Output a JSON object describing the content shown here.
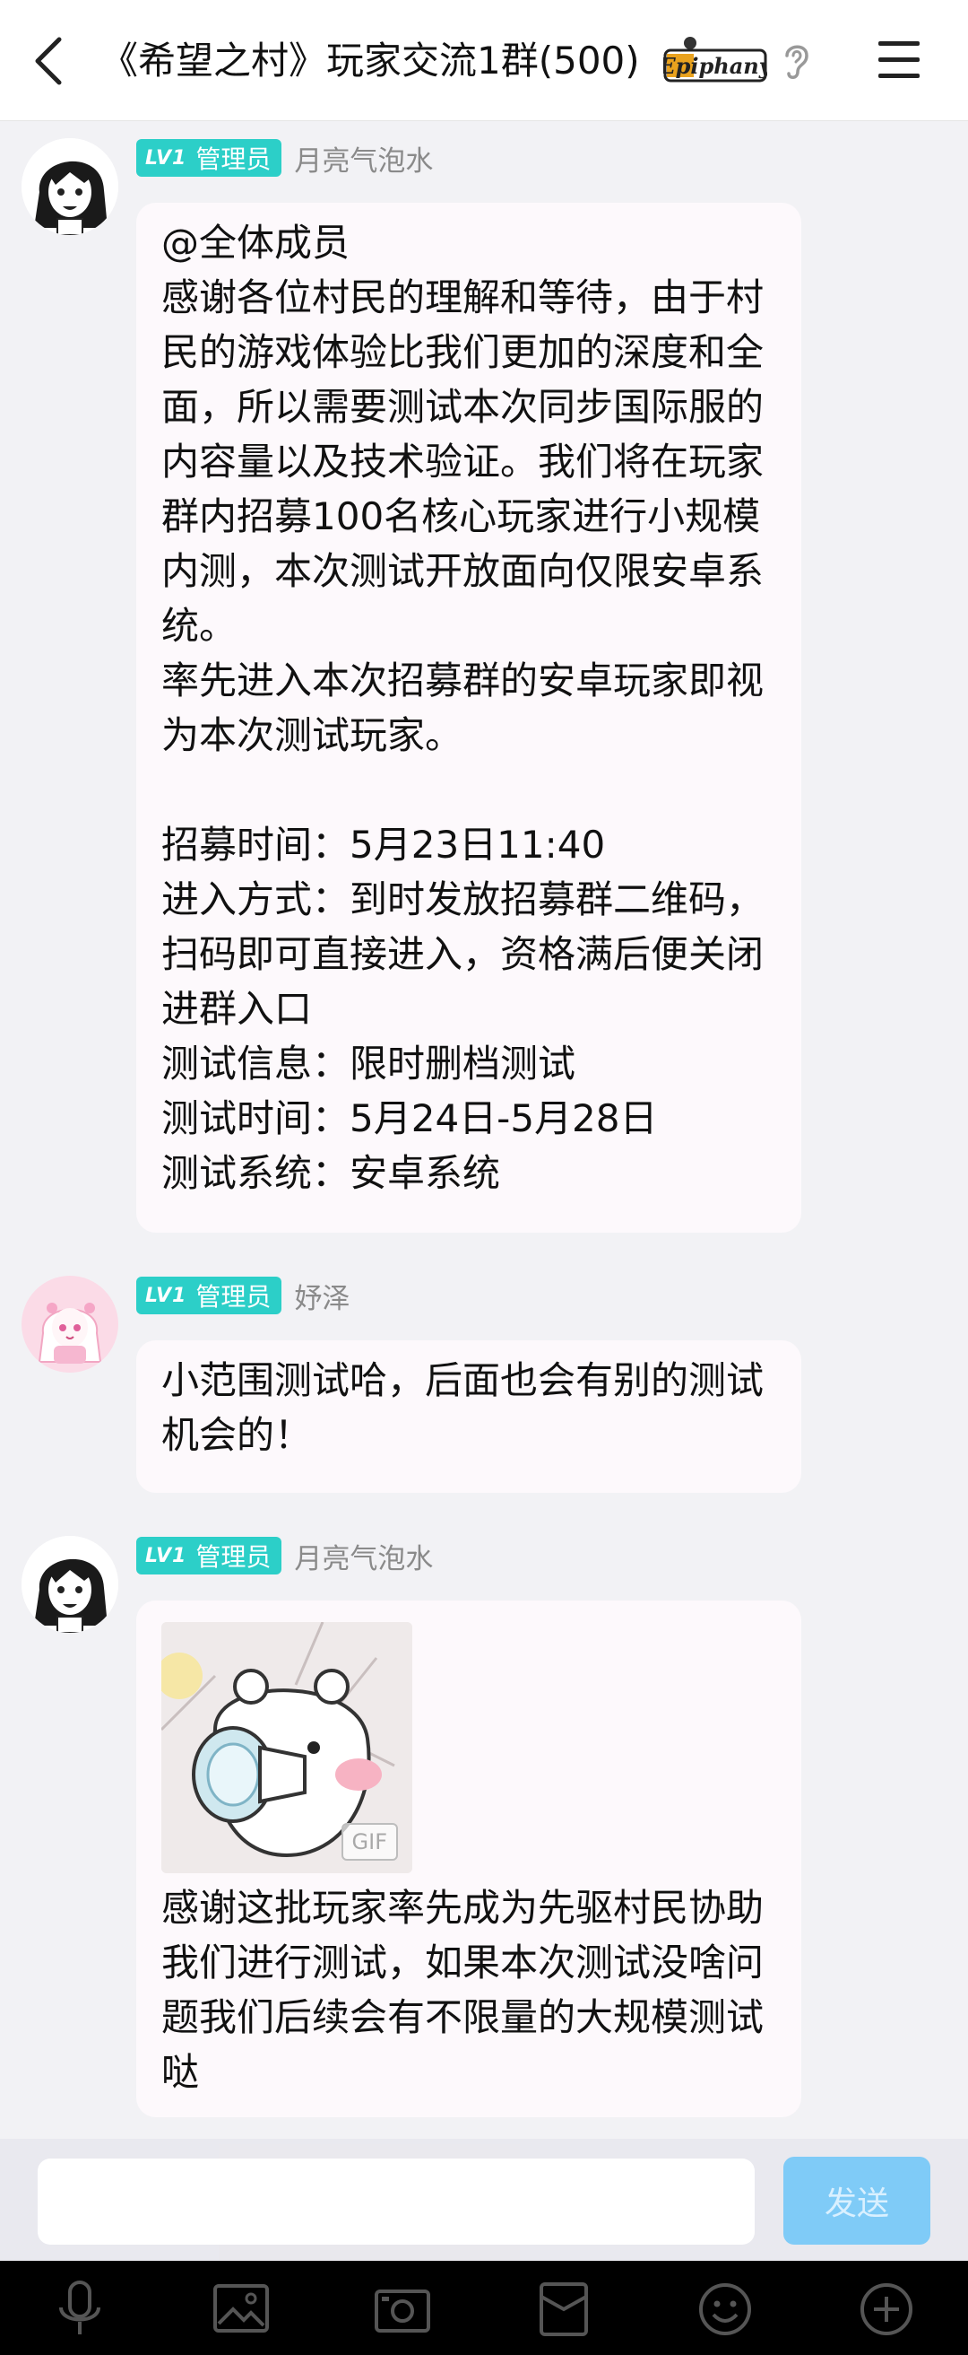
{
  "header": {
    "title": "《希望之村》玩家交流1群(500)",
    "brand_logo_text": "Epiphany"
  },
  "messages": [
    {
      "role_level": "LV1",
      "role": "管理员",
      "sender": "月亮气泡水",
      "text": "@全体成员\n感谢各位村民的理解和等待，由于村民的游戏体验比我们更加的深度和全面，所以需要测试本次同步国际服的内容量以及技术验证。我们将在玩家群内招募100名核心玩家进行小规模内测，本次测试开放面向仅限安卓系统。\n率先进入本次招募群的安卓玩家即视为本次测试玩家。\n\n招募时间：5月23日11:40\n进入方式：到时发放招募群二维码，扫码即可直接进入，资格满后便关闭进群入口\n测试信息：限时删档测试\n测试时间：5月24日-5月28日\n测试系统：安卓系统"
    },
    {
      "role_level": "LV1",
      "role": "管理员",
      "sender": "妤泽",
      "text": "小范围测试哈，后面也会有别的测试机会的！"
    },
    {
      "role_level": "LV1",
      "role": "管理员",
      "sender": "月亮气泡水",
      "sticker_badge": "GIF",
      "text": "感谢这批玩家率先成为先驱村民协助我们进行测试，如果本次测试没啥问题我们后续会有不限量的大规模测试哒"
    }
  ],
  "input": {
    "value": "",
    "placeholder": "",
    "send_label": "发送"
  },
  "toolbar": {
    "icons": [
      "microphone-icon",
      "image-icon",
      "camera-icon",
      "red-packet-icon",
      "emoji-icon",
      "plus-icon"
    ]
  },
  "colors": {
    "badge": "#2ccfc8",
    "send_button": "#7fcbf7",
    "bubble": "#fdf9fc",
    "background": "#f2f2f5"
  }
}
